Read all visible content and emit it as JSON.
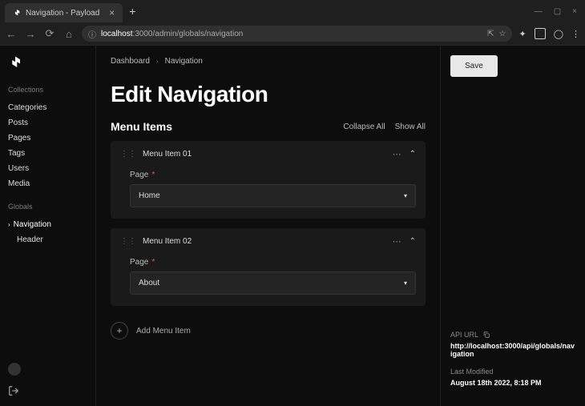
{
  "browser": {
    "tab_title": "Navigation - Payload",
    "url_host": "localhost",
    "url_path": ":3000/admin/globals/navigation"
  },
  "sidebar": {
    "sections": {
      "collections_label": "Collections",
      "globals_label": "Globals"
    },
    "collections": [
      {
        "label": "Categories"
      },
      {
        "label": "Posts"
      },
      {
        "label": "Pages"
      },
      {
        "label": "Tags"
      },
      {
        "label": "Users"
      },
      {
        "label": "Media"
      }
    ],
    "globals": [
      {
        "label": "Navigation",
        "active": true
      },
      {
        "label": "Header"
      }
    ]
  },
  "breadcrumb": {
    "root": "Dashboard",
    "current": "Navigation"
  },
  "page": {
    "title": "Edit Navigation",
    "array_title": "Menu Items",
    "collapse_all": "Collapse All",
    "show_all": "Show All",
    "add_item_label": "Add Menu Item"
  },
  "items": [
    {
      "title": "Menu Item 01",
      "field_label": "Page",
      "value": "Home"
    },
    {
      "title": "Menu Item 02",
      "field_label": "Page",
      "value": "About"
    }
  ],
  "right": {
    "save_label": "Save",
    "api_url_label": "API URL",
    "api_url_value": "http://localhost:3000/api/globals/navigation",
    "last_modified_label": "Last Modified",
    "last_modified_value": "August 18th 2022, 8:18 PM"
  }
}
